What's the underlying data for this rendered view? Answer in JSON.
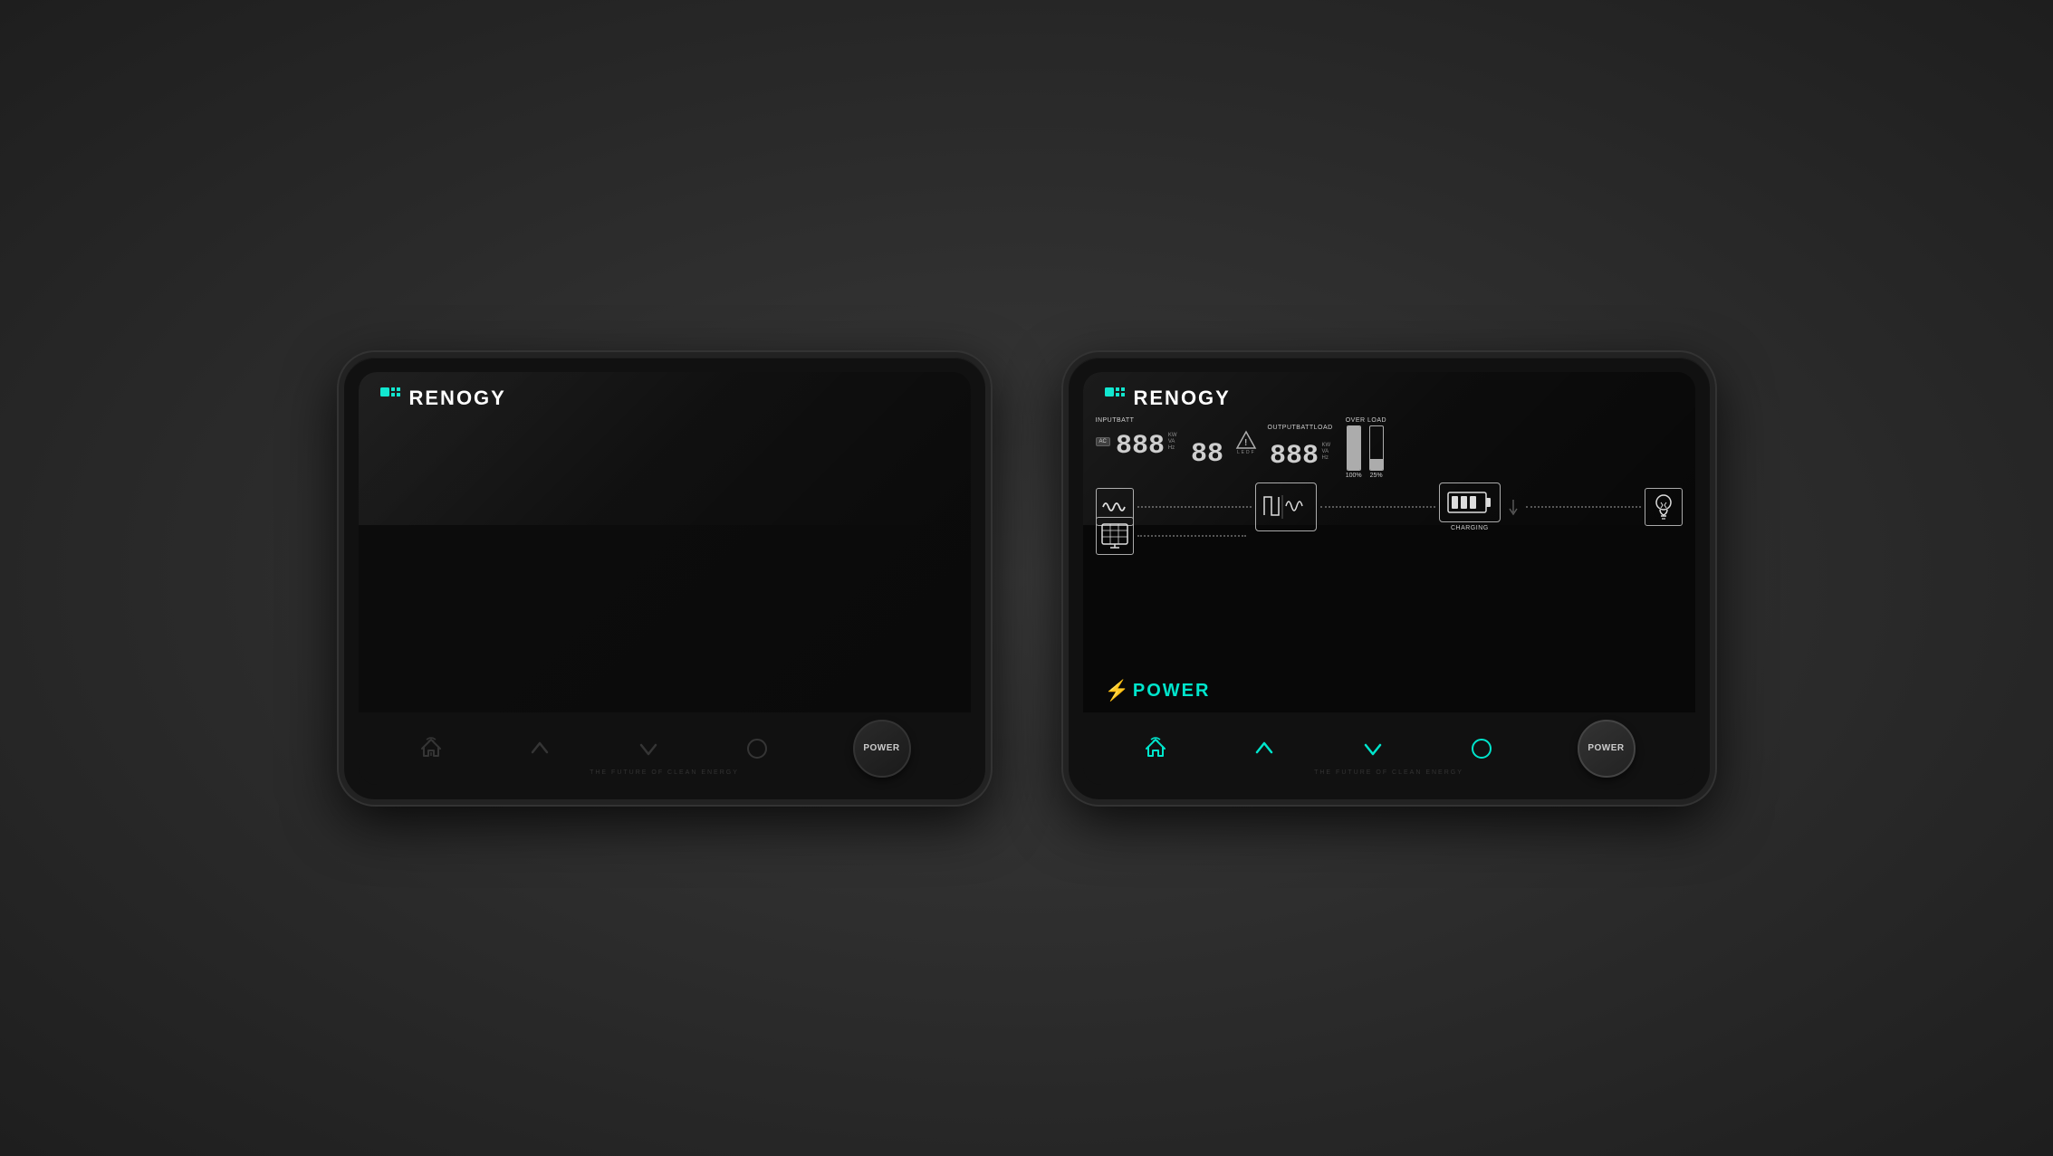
{
  "brand": {
    "name": "RENOGY",
    "tagline": "THE FUTURE OF CLEAN ENERGY"
  },
  "device_off": {
    "logo": "RENOGY",
    "tagline": "THE FUTURE OF CLEAN ENERGY",
    "buttons": {
      "home": "home",
      "up": "up",
      "down": "down",
      "menu": "menu",
      "power": "POWER"
    }
  },
  "device_on": {
    "logo": "RENOGY",
    "tagline": "THE FUTURE OF CLEAN ENERGY",
    "display": {
      "input_label": "INPUTBATT",
      "ac_badge": "AC",
      "input_digits": "888",
      "input_units": [
        "KW",
        "VA",
        "Hz"
      ],
      "middle_digits": "88",
      "output_label": "OUTPUTBATTLOAD",
      "output_units": [
        "KW",
        "VA",
        "Hz"
      ],
      "output_digits": "888",
      "warning_label": "OVER LOAD",
      "load_percent_100": "100%",
      "load_percent_25": "25%",
      "charging_label": "CHARGING",
      "power_label": "POWER",
      "flow_labels": [
        "AC sine",
        "inverter",
        "battery",
        "solar",
        "load bulb"
      ]
    },
    "buttons": {
      "home": "home",
      "up": "up",
      "down": "down",
      "menu": "menu",
      "power": "POWER"
    }
  },
  "colors": {
    "teal": "#00e5cc",
    "screen_bg": "#080808",
    "device_bg": "#111111",
    "text_dim": "#888888",
    "text_bright": "#cccccc"
  }
}
